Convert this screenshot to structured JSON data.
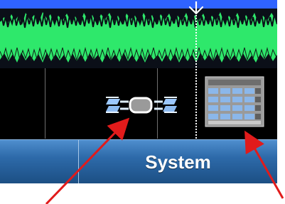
{
  "tabs": {
    "left_label": "",
    "system_label": "System"
  },
  "icons": {
    "marker": "down-arrow-marker-icon",
    "link": "link-chain-icon",
    "keypad": "keypad-grid-icon"
  },
  "colors": {
    "spectrum_blue": "#1d4fff",
    "spectrum_green": "#2ee86b",
    "tab_blue": "#2d6aa9",
    "callout_red": "#e11b1b"
  }
}
